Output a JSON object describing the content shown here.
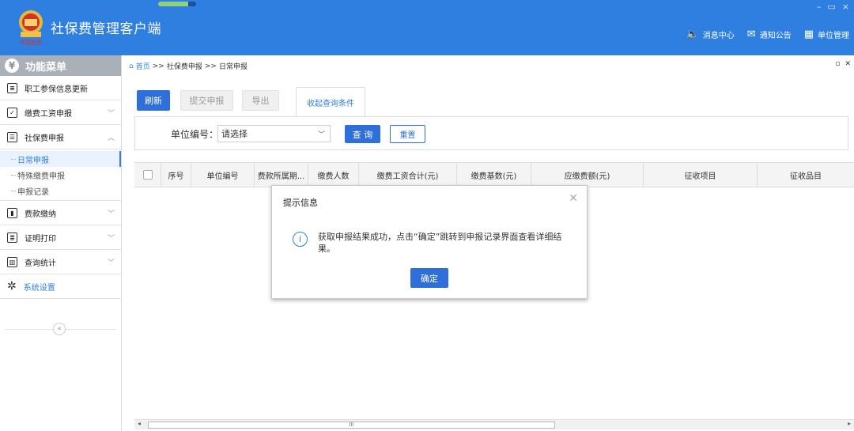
{
  "header": {
    "app_title": "社保费管理客户端",
    "progress": 0.8,
    "win_controls": [
      "–",
      "▭",
      "×"
    ],
    "links": [
      {
        "icon": "speaker-icon",
        "label": "消息中心"
      },
      {
        "icon": "mail-icon",
        "label": "通知公告"
      },
      {
        "icon": "building-icon",
        "label": "单位管理"
      }
    ]
  },
  "sidebar": {
    "title": "功能菜单",
    "items": [
      {
        "label": "职工参保信息更新",
        "icon": "list-icon"
      },
      {
        "label": "缴费工资申报",
        "icon": "edit-icon"
      },
      {
        "label": "社保费申报",
        "icon": "document-icon"
      },
      {
        "label": "费款缴纳",
        "icon": "wallet-icon"
      },
      {
        "label": "证明打印",
        "icon": "print-icon"
      },
      {
        "label": "查询统计",
        "icon": "chart-icon"
      },
      {
        "label": "系统设置",
        "icon": "gear-icon"
      }
    ],
    "sub_items": [
      "日常申报",
      "特殊缴费申报",
      "申报记录"
    ],
    "collapse": "«"
  },
  "breadcrumb": {
    "home": "首页",
    "sep": ">>",
    "path1": "社保费申报",
    "path2": "日常申报"
  },
  "toolbar": {
    "refresh": "刷新",
    "submit": "提交申报",
    "export": "导出",
    "collapse_query": "收起查询条件"
  },
  "query": {
    "unit_label": "单位编号：",
    "unit_value": "请选择",
    "query_btn": "查 询",
    "reset_btn": "重置"
  },
  "table": {
    "columns": [
      "序号",
      "单位编号",
      "费款所属期...",
      "缴费人数",
      "缴费工资合计(元)",
      "缴费基数(元)",
      "应缴费额(元)",
      "征收项目",
      "征收品目"
    ]
  },
  "scrollbar": {
    "thumb_mark": "III"
  },
  "dialog": {
    "title": "提示信息",
    "message": "获取申报结果成功，点击“确定”跳转到申报记录界面查看详细结果。",
    "ok": "确定",
    "close": "✕"
  }
}
